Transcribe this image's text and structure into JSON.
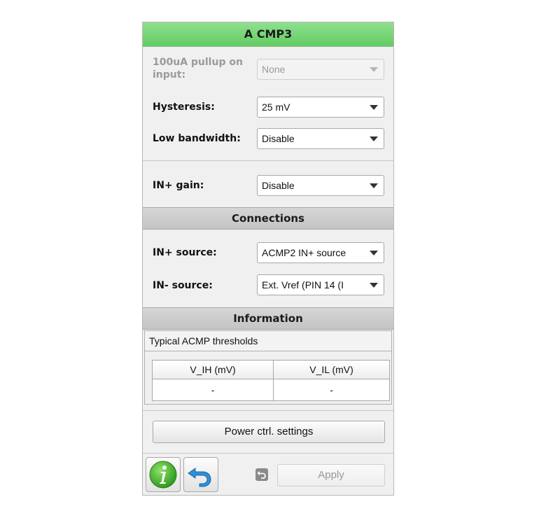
{
  "window": {
    "title": "A CMP3"
  },
  "settings": {
    "pullup": {
      "label_line1": "100uA pullup on",
      "label_line2": "input:",
      "value": "None"
    },
    "hysteresis": {
      "label": "Hysteresis:",
      "value": "25 mV"
    },
    "low_bandwidth": {
      "label": "Low bandwidth:",
      "value": "Disable"
    },
    "in_gain": {
      "label": "IN+ gain:",
      "value": "Disable"
    }
  },
  "connections": {
    "header": "Connections",
    "in_plus_source": {
      "label": "IN+ source:",
      "value": "ACMP2 IN+ source"
    },
    "in_minus_source": {
      "label": "IN- source:",
      "value": "Ext. Vref (PIN 14 (I"
    }
  },
  "information": {
    "header": "Information",
    "thresholds_title": "Typical ACMP thresholds",
    "table": {
      "columns": [
        "V_IH (mV)",
        "V_IL (mV)"
      ],
      "rows": [
        [
          "-",
          "-"
        ]
      ]
    }
  },
  "buttons": {
    "power_ctrl": "Power ctrl. settings",
    "apply": "Apply"
  },
  "icons": {
    "info": "info-icon",
    "undo": "undo-icon",
    "revert": "revert-icon"
  },
  "colors": {
    "title_bar": "#6fd36f",
    "info_icon": "#3fae2a",
    "undo_icon": "#2f8fd6"
  }
}
